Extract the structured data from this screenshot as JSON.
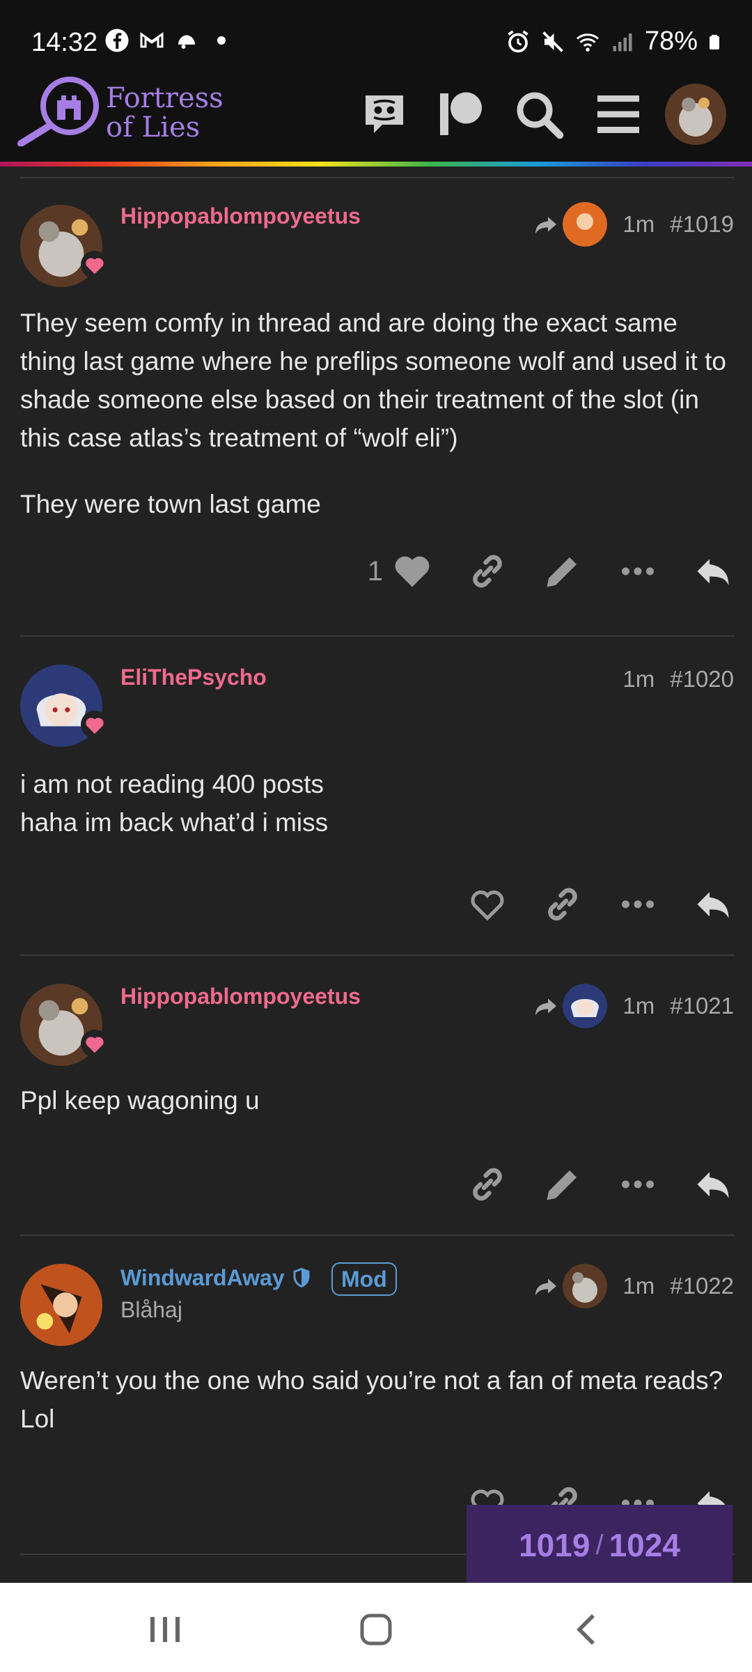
{
  "status_bar": {
    "time": "14:32",
    "battery": "78%",
    "left_icons": [
      "facebook-icon",
      "gmail-icon",
      "notification-icon",
      "dot-icon"
    ],
    "right_icons": [
      "alarm-icon",
      "mute-icon",
      "wifi-icon",
      "signal-icon",
      "battery-icon"
    ]
  },
  "header": {
    "logo_line1": "Fortress",
    "logo_line2": "of Lies",
    "icons": [
      "discord-icon",
      "patreon-icon",
      "search-icon",
      "menu-icon",
      "user-avatar"
    ]
  },
  "posts": [
    {
      "username": "Hippopablompoyeetus",
      "time": "1m",
      "number": "#1019",
      "paragraphs": [
        "They seem comfy in thread and are doing the exact same thing last game where he preflips someone wolf and used it to shade someone else based on their treatment of the slot (in this case atlas’s treatment of “wolf eli”)",
        "They were town last game"
      ],
      "likes": "1"
    },
    {
      "username": "EliThePsycho",
      "time": "1m",
      "number": "#1020",
      "paragraphs": [
        "i am not reading 400 posts",
        "haha im back what’d i miss"
      ]
    },
    {
      "username": "Hippopablompoyeetus",
      "time": "1m",
      "number": "#1021",
      "paragraphs": [
        "Ppl keep wagoning u"
      ]
    },
    {
      "username": "WindwardAway",
      "badge": "Mod",
      "subtitle": "Blåhaj",
      "time": "1m",
      "number": "#1022",
      "paragraphs": [
        "Weren’t you the one who said you’re not a fan of meta reads? Lol"
      ]
    }
  ],
  "progress": {
    "current": "1019",
    "separator": "/",
    "total": "1024"
  },
  "colors": {
    "background": "#222222",
    "username_pink": "#f06a8f",
    "mod_blue": "#5b9bd5",
    "brand_purple": "#a67ee5"
  }
}
